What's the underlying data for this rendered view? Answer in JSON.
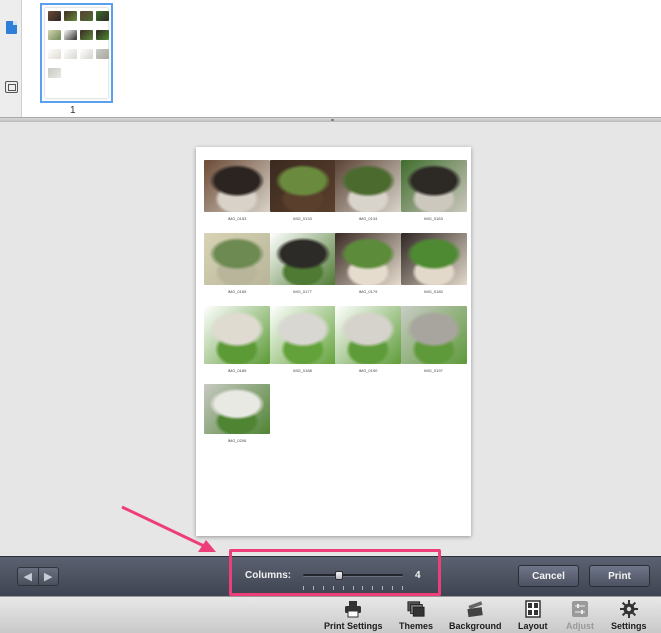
{
  "sidebar": {
    "icons": [
      "document-icon",
      "pages-icon"
    ]
  },
  "thumbnails": {
    "page_number": "1"
  },
  "sheet": {
    "photos": [
      {
        "caption": "IMG_0153",
        "palette": [
          "#6b4a36",
          "#d8d2c8",
          "#2b2421"
        ]
      },
      {
        "caption": "IMG_0133",
        "palette": [
          "#3b2a20",
          "#5a3f2c",
          "#6a8a3d"
        ]
      },
      {
        "caption": "IMG_0134",
        "palette": [
          "#5a4234",
          "#d9d4cb",
          "#4b6b2e"
        ]
      },
      {
        "caption": "IMG_0163",
        "palette": [
          "#3f6d2d",
          "#ccc8be",
          "#2d2a26"
        ]
      },
      {
        "caption": "IMG_0165",
        "palette": [
          "#d8d3b4",
          "#b8b59a",
          "#6d8a52"
        ]
      },
      {
        "caption": "IMG_0177",
        "palette": [
          "#ffffff",
          "#4e7a33",
          "#2d2b27"
        ]
      },
      {
        "caption": "IMG_0179",
        "palette": [
          "#3a2a24",
          "#e5dcce",
          "#5c8b3a"
        ]
      },
      {
        "caption": "IMG_0180",
        "palette": [
          "#2f2522",
          "#e2d9ca",
          "#4e8a32"
        ]
      },
      {
        "caption": "IMG_0185",
        "palette": [
          "#ffffff",
          "#5c9a36",
          "#e0dbd1"
        ]
      },
      {
        "caption": "IMG_0188",
        "palette": [
          "#ffffff",
          "#63a23a",
          "#d9d7d2"
        ]
      },
      {
        "caption": "IMG_0190",
        "palette": [
          "#ffffff",
          "#5e9c39",
          "#d6d3cc"
        ]
      },
      {
        "caption": "IMG_0197",
        "palette": [
          "#c9ccc6",
          "#5f9a3a",
          "#a8a59e"
        ]
      },
      {
        "caption": "IMG_0206",
        "palette": [
          "#c8c9c3",
          "#4f8433",
          "#e9e9e4"
        ]
      }
    ]
  },
  "controls": {
    "columns_label": "Columns:",
    "columns_value": "4",
    "slider_fraction": 0.35,
    "slider_ticks": 11,
    "cancel_label": "Cancel",
    "print_label": "Print",
    "highlight_color": "#ee3e7a"
  },
  "toolbar": {
    "items": [
      {
        "label": "Print Settings",
        "icon": "printer-icon",
        "enabled": true
      },
      {
        "label": "Themes",
        "icon": "themes-icon",
        "enabled": true
      },
      {
        "label": "Background",
        "icon": "background-icon",
        "enabled": true
      },
      {
        "label": "Layout",
        "icon": "layout-icon",
        "enabled": true
      },
      {
        "label": "Adjust",
        "icon": "adjust-icon",
        "enabled": false
      },
      {
        "label": "Settings",
        "icon": "gear-icon",
        "enabled": true
      }
    ]
  }
}
